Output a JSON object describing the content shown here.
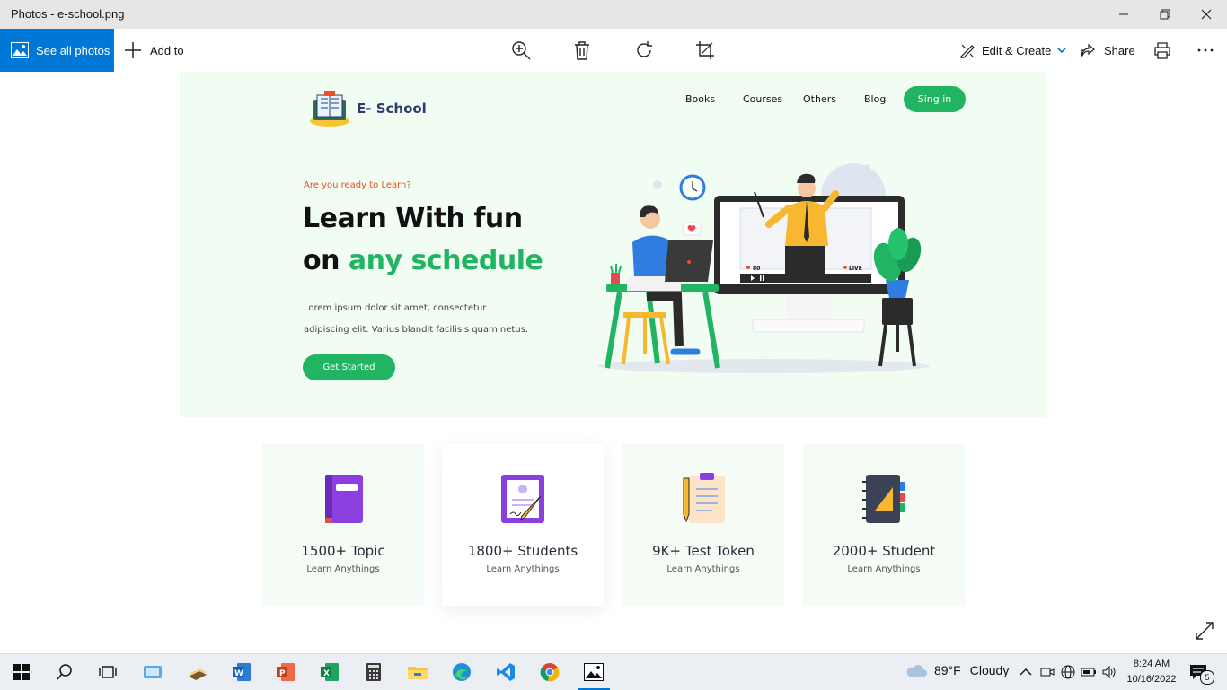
{
  "window": {
    "title": "Photos - e-school.png"
  },
  "toolbar": {
    "see_all_photos": "See all photos",
    "add_to": "Add to",
    "edit_create": "Edit & Create",
    "share": "Share"
  },
  "site": {
    "brand": "E- School",
    "nav": [
      "Books",
      "Courses",
      "Others",
      "Blog"
    ],
    "signin": "Sing in",
    "eyebrow": "Are you ready to Learn?",
    "headline_line1": "Learn With fun",
    "headline_on": "on",
    "headline_highlight": "any schedule",
    "lorem_line1": "Lorem ipsum dolor sit amet, consectetur",
    "lorem_line2": "adipiscing elit. Varius blandit facilisis quam netus.",
    "cta": "Get Started",
    "video_views": "80",
    "live": "LIVE"
  },
  "stats": [
    {
      "value": "1500+ Topic",
      "label": "Learn Anythings",
      "icon": "book-icon"
    },
    {
      "value": "1800+ Students",
      "label": "Learn Anythings",
      "icon": "certificate-icon"
    },
    {
      "value": "9K+ Test Token",
      "label": "Learn Anythings",
      "icon": "clipboard-icon"
    },
    {
      "value": "2000+ Student",
      "label": "Learn Anythings",
      "icon": "notebook-icon"
    }
  ],
  "taskbar": {
    "weather": {
      "temp": "89°F",
      "condition": "Cloudy"
    },
    "time": "8:24 AM",
    "date": "10/16/2022",
    "notifications": "5"
  },
  "colors": {
    "accent": "#20b463",
    "brand": "#2d3a6b",
    "eyebrow": "#e8501f",
    "windows_blue": "#0078d7",
    "hero_bg": "#f1fdf3"
  }
}
